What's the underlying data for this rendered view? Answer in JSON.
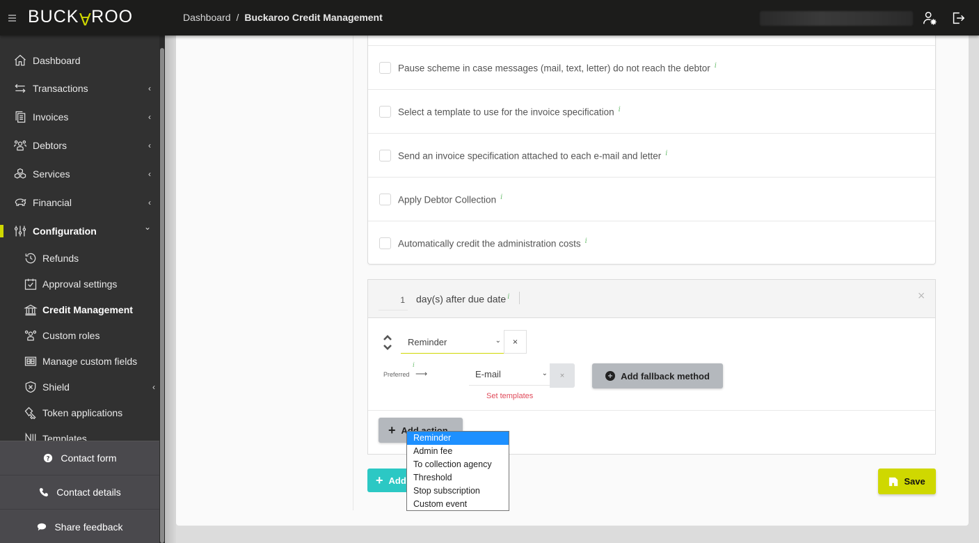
{
  "header": {
    "logo": {
      "pre": "BUCK",
      "accent": "A",
      "post": "ROO"
    },
    "breadcrumb": [
      {
        "label": "Dashboard"
      },
      {
        "label": "Buckaroo Credit Management"
      }
    ],
    "breadcrumb_separator": "/",
    "icons": [
      "menu-icon",
      "user-settings-icon",
      "logout-icon"
    ]
  },
  "sidebar": {
    "items": [
      {
        "label": "Dashboard",
        "icon": "home-icon",
        "expandable": false
      },
      {
        "label": "Transactions",
        "icon": "transactions-icon",
        "expandable": true
      },
      {
        "label": "Invoices",
        "icon": "invoices-icon",
        "expandable": true
      },
      {
        "label": "Debtors",
        "icon": "debtors-icon",
        "expandable": true
      },
      {
        "label": "Services",
        "icon": "services-icon",
        "expandable": true
      },
      {
        "label": "Financial",
        "icon": "piggy-bank-icon",
        "expandable": true
      },
      {
        "label": "Configuration",
        "icon": "sliders-icon",
        "expandable": true,
        "expanded": true,
        "active": true
      }
    ],
    "sub_items": [
      {
        "label": "Refunds",
        "icon": "history-icon"
      },
      {
        "label": "Approval settings",
        "icon": "calendar-check-icon"
      },
      {
        "label": "Credit Management",
        "icon": "bank-icon",
        "active": true
      },
      {
        "label": "Custom roles",
        "icon": "users-icon"
      },
      {
        "label": "Manage custom fields",
        "icon": "fields-icon"
      },
      {
        "label": "Shield",
        "icon": "shield-icon",
        "expandable": true
      },
      {
        "label": "Token applications",
        "icon": "key-icon"
      },
      {
        "label": "Templates",
        "icon": "templates-icon"
      }
    ],
    "footer": [
      {
        "label": "Contact form",
        "icon": "question-circle-icon"
      },
      {
        "label": "Contact details",
        "icon": "phone-icon"
      },
      {
        "label": "Share feedback",
        "icon": "comment-icon"
      }
    ],
    "chevron_collapsed": "‹",
    "chevron_expanded": "⌄"
  },
  "options": [
    {
      "label": "Pause scheme in case messages (mail, text, letter) do not reach the debtor",
      "checked": false
    },
    {
      "label": "Select a template to use for the invoice specification",
      "checked": false
    },
    {
      "label": "Send an invoice specification attached to each e-mail and letter",
      "checked": false
    },
    {
      "label": "Apply Debtor Collection",
      "checked": false
    },
    {
      "label": "Automatically credit the administration costs",
      "checked": false
    }
  ],
  "info_glyph": "i",
  "step": {
    "days_value": "1",
    "days_label": "day(s) after due date",
    "close_glyph": "×",
    "action": {
      "selected": "Reminder",
      "caret": "⌄",
      "remove_glyph": "×"
    },
    "preferred_label": "Preferred",
    "arrow": "⟶",
    "method": {
      "selected": "E-mail",
      "caret": "⌄",
      "remove_glyph": "×"
    },
    "set_templates_label": "Set templates",
    "fallback_label": "Add fallback method",
    "add_action_label": "Add action"
  },
  "add_step_label": "Add step",
  "save_label": "Save",
  "dropdown": {
    "options": [
      "Reminder",
      "Admin fee",
      "To collection agency",
      "Threshold",
      "Stop subscription",
      "Custom event"
    ],
    "selected_index": 0
  },
  "colors": {
    "accent": "#cfd800",
    "teal": "#2cc8c4",
    "danger": "#e04a5a",
    "info": "#6fbf73",
    "sidebar_bg": "#313131",
    "topbar_bg": "#1c1c1b"
  }
}
